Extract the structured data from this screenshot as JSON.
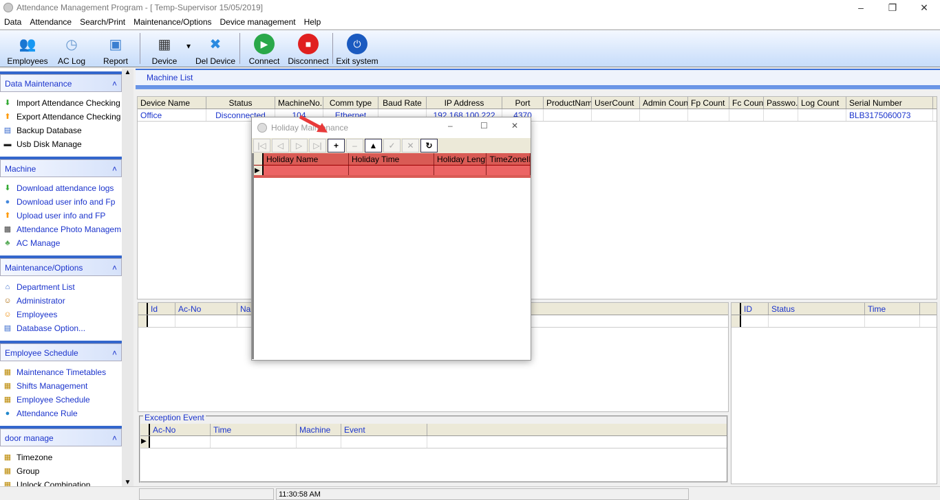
{
  "window": {
    "title": "Attendance Management Program - [ Temp-Supervisor 15/05/2019]"
  },
  "menu": [
    "Data",
    "Attendance",
    "Search/Print",
    "Maintenance/Options",
    "Device management",
    "Help"
  ],
  "toolbar": [
    {
      "label": "Employees",
      "icon": "employees-icon",
      "color": "#e08020"
    },
    {
      "label": "AC Log",
      "icon": "clock-icon",
      "color": "#6a9ad0"
    },
    {
      "label": "Report",
      "icon": "report-folder-icon",
      "color": "#3a7fd0"
    },
    {
      "label": "Device",
      "icon": "device-icon",
      "color": "#333333"
    },
    {
      "label": "Del Device",
      "icon": "x-icon",
      "color": "#2a8ae0"
    },
    {
      "label": "Connect",
      "icon": "play-icon",
      "color": "#2aa84a"
    },
    {
      "label": "Disconnect",
      "icon": "stop-icon",
      "color": "#e02020"
    },
    {
      "label": "Exit system",
      "icon": "power-icon",
      "color": "#1a5ac0"
    }
  ],
  "sidebar": [
    {
      "title": "Data Maintenance",
      "items": [
        "Import Attendance Checking ...",
        "Export Attendance Checking ...",
        "Backup Database",
        "Usb Disk Manage"
      ],
      "blue": false
    },
    {
      "title": "Machine",
      "items": [
        "Download attendance logs",
        "Download user info and Fp",
        "Upload user info and FP",
        "Attendance Photo Managem...",
        "AC Manage"
      ],
      "blue": true
    },
    {
      "title": "Maintenance/Options",
      "items": [
        "Department List",
        "Administrator",
        "Employees",
        "Database Option..."
      ],
      "blue": true
    },
    {
      "title": "Employee Schedule",
      "items": [
        "Maintenance Timetables",
        "Shifts Management",
        "Employee Schedule",
        "Attendance Rule"
      ],
      "blue": true
    },
    {
      "title": "door manage",
      "items": [
        "Timezone",
        "Group",
        "Unlock Combination"
      ],
      "blue": false
    }
  ],
  "machine_list": {
    "title": "Machine List",
    "columns": [
      "Device Name",
      "Status",
      "MachineNo.",
      "Comm type",
      "Baud Rate",
      "IP Address",
      "Port",
      "ProductName",
      "UserCount",
      "Admin Count",
      "Fp Count",
      "Fc Count",
      "Passwo...",
      "Log Count",
      "Serial Number"
    ],
    "rows": [
      [
        "Office",
        "Disconnected",
        "104",
        "Ethernet",
        "",
        "192.168.100.222",
        "4370",
        "",
        "",
        "",
        "",
        "",
        "",
        "",
        "BLB3175060073"
      ]
    ]
  },
  "log_grid": {
    "columns": [
      "Id",
      "Ac-No",
      "Name"
    ]
  },
  "status_grid": {
    "columns": [
      "ID",
      "Status",
      "Time"
    ]
  },
  "exception": {
    "title": "Exception Event",
    "columns": [
      "Ac-No",
      "Time",
      "Machine",
      "Event"
    ]
  },
  "dialog": {
    "title": "Holiday Maintenance",
    "nav": [
      "first",
      "prior",
      "next",
      "last",
      "insert",
      "delete",
      "edit",
      "post",
      "cancel",
      "refresh"
    ],
    "columns": [
      "Holiday Name",
      "Holiday Time",
      "Holiday Length",
      "TimeZoneID"
    ]
  },
  "status": {
    "time": "11:30:58 AM"
  }
}
